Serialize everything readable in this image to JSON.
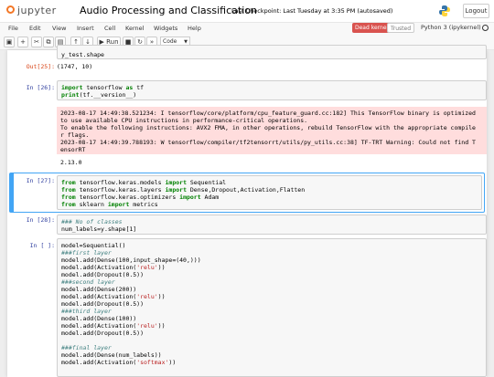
{
  "header": {
    "logo_text": "jupyter",
    "title": "Audio Processing and Classification",
    "checkpoint": "Last Checkpoint: Last Tuesday at 3:35 PM  (autosaved)",
    "logout": "Logout"
  },
  "menu": {
    "items": [
      "File",
      "Edit",
      "View",
      "Insert",
      "Cell",
      "Kernel",
      "Widgets",
      "Help"
    ],
    "kernel_status": "Dead kernel",
    "trusted": "Trusted",
    "kernel_name": "Python 3 (ipykernel)"
  },
  "toolbar": {
    "run_label": "▶ Run",
    "cell_type": "Code"
  },
  "cells": {
    "c0": {
      "line": "y_test.shape"
    },
    "out25": {
      "prompt": "Out[25]:",
      "text": "(1747, 10)"
    },
    "c26": {
      "prompt": "In [26]:",
      "lines": [
        "import tensorflow as tf",
        "print(tf.__version__)"
      ],
      "stderr": [
        "2023-08-17 14:49:38.521234: I tensorflow/core/platform/cpu_feature_guard.cc:182] This TensorFlow binary is optimized",
        "to use available CPU instructions in performance-critical operations.",
        "To enable the following instructions: AVX2 FMA, in other operations, rebuild TensorFlow with the appropriate compile",
        "r flags.",
        "2023-08-17 14:49:39.788193: W tensorflow/compiler/tf2tensorrt/utils/py_utils.cc:38] TF-TRT Warning: Could not find T",
        "ensorRT"
      ],
      "output": "2.13.0"
    },
    "c27": {
      "prompt": "In [27]:",
      "lines": [
        "from tensorflow.keras.models import Sequential",
        "from tensorflow.keras.layers import Dense,Dropout,Activation,Flatten",
        "from tensorflow.keras.optimizers import Adam",
        "from sklearn import metrics"
      ]
    },
    "c28": {
      "prompt": "In [28]:",
      "lines": [
        "### No of classes",
        "num_labels=y.shape[1]"
      ]
    },
    "c29": {
      "prompt": "In [ ]:",
      "lines": [
        "model=Sequential()",
        "###first layer",
        "model.add(Dense(100,input_shape=(40,)))",
        "model.add(Activation('relu'))",
        "model.add(Dropout(0.5))",
        "###second layer",
        "model.add(Dense(200))",
        "model.add(Activation('relu'))",
        "model.add(Dropout(0.5))",
        "###third layer",
        "model.add(Dense(100))",
        "model.add(Activation('relu'))",
        "model.add(Dropout(0.5))",
        "",
        "###final layer",
        "model.add(Dense(num_labels))",
        "model.add(Activation('softmax'))"
      ]
    }
  },
  "colors": {
    "accent": "#f37726",
    "dead_kernel": "#d9534f",
    "selected": "#42a5f5",
    "stderr_bg": "#ffdddd"
  },
  "icons": [
    "save-icon",
    "add-cell-icon",
    "cut-icon",
    "copy-icon",
    "paste-icon",
    "move-up-icon",
    "move-down-icon",
    "run-icon",
    "stop-icon",
    "restart-icon",
    "fast-forward-icon",
    "python-logo-icon"
  ]
}
